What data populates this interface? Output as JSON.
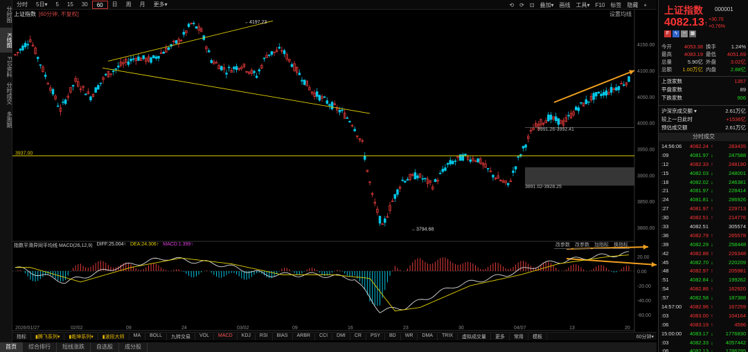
{
  "toolbar": {
    "items": [
      "分时",
      "5日▾",
      "5",
      "15",
      "30",
      "60",
      "日",
      "周",
      "月",
      "更多▾"
    ],
    "active_index": 5,
    "right_items": [
      "⟲",
      "⟳",
      "⊡",
      "叠加▾",
      "画线",
      "工具▾",
      "F10",
      "标签",
      "隐藏",
      "+"
    ]
  },
  "vtabs": [
    "分时图",
    "K线图",
    "F10资料",
    "分时成交",
    "多周期"
  ],
  "vtab_active": 1,
  "chart": {
    "title": "上证指数",
    "subtitle": "[60分钟, 不复权]",
    "settings": "设置均线",
    "y_labels": [
      "4150.00",
      "4100.00",
      "4050.00",
      "4000.00",
      "3950.00",
      "3900.00",
      "3850.00",
      "3800.00"
    ],
    "x_labels": [
      "2026/01/27",
      "02/02",
      "09",
      "24",
      "03/02",
      "09",
      "16",
      "23",
      "30",
      "04/07",
      "13",
      "20"
    ],
    "support_label": "3937.00",
    "annot_high": "4197.23",
    "annot_low": "3794.68",
    "annot_zone1": "3991.26-3992.41",
    "annot_zone2": "3891.02-3928.25",
    "colors": {
      "up": "#e83b3b",
      "down": "#00c8e8",
      "trend": "#e6d200",
      "arrow": "#f0a020"
    }
  },
  "indicator": {
    "label": "指数平滑异同平均线 MACD(26,12,9)",
    "diff": "DIFF:25.004↑",
    "dea": "DEA:24.306↑",
    "macd": "MACD:1.399↑",
    "buttons": [
      "改参数",
      "改参数",
      "加指标",
      "换指标"
    ],
    "y_labels": [
      "20.00",
      "0.00",
      "-20.00",
      "-40.00",
      "-60.00"
    ]
  },
  "ind_tabs": [
    "指标",
    "▮腾飞系列▾",
    "▮乾坤系列▾",
    "▮波段大师",
    "MA",
    "BOLL",
    "九转交易",
    "VOL",
    "MACD",
    "KDJ",
    "RSI",
    "BIAS",
    "ARBR",
    "CCI",
    "DMI",
    "CR",
    "PSY",
    "BD",
    "WR",
    "DMA",
    "TRIX",
    "虚拟成交量",
    "更多",
    "常用",
    "模板"
  ],
  "ind_tab_active": 8,
  "period": "60分钟▾",
  "sheet_tabs": [
    "首页",
    "综合排行",
    "短线涨跌",
    "自选股",
    "成分股"
  ],
  "quote": {
    "name": "上证指数",
    "code": "000001",
    "price": "4082.13",
    "arrow": "↑",
    "change": "+30.70",
    "change_pct": "+0.76%",
    "rows": [
      {
        "k": "今开",
        "v": "4053.38",
        "vc": "red",
        "k2": "换手",
        "v2": "1.24%",
        "v2c": "white"
      },
      {
        "k": "最高",
        "v": "4083.19",
        "vc": "red",
        "k2": "最低",
        "v2": "4051.69",
        "v2c": "red"
      },
      {
        "k": "总量",
        "v": "5.90亿",
        "vc": "white",
        "k2": "外盘",
        "v2": "3.02亿",
        "v2c": "red"
      },
      {
        "k": "总额",
        "v": "1.00万亿",
        "vc": "yellow",
        "k2": "内盘",
        "v2": "2.88亿",
        "v2c": "green"
      }
    ],
    "stats": [
      {
        "k": "上涨家数",
        "v": "1357",
        "c": "red"
      },
      {
        "k": "平盘家数",
        "v": "89",
        "c": "white"
      },
      {
        "k": "下跌家数",
        "v": "906",
        "c": "green"
      }
    ],
    "stats2": [
      {
        "k": "沪深京成交额 ▾",
        "v": "2.61万亿",
        "c": "white"
      },
      {
        "k": "较上一日此时",
        "v": "+1536亿",
        "c": "red"
      },
      {
        "k": "预估成交额",
        "v": "2.61万亿",
        "c": "white"
      }
    ],
    "ticks_header": "分时成交",
    "ticks": [
      {
        "t": "14:56:06",
        "p": "4082.24",
        "a": "↑",
        "v": "283435",
        "c": "red"
      },
      {
        "t": ":09",
        "p": "4081.97",
        "a": "↓",
        "v": "247588",
        "c": "green"
      },
      {
        "t": ":12",
        "p": "4082.33",
        "a": "↑",
        "v": "248190",
        "c": "red"
      },
      {
        "t": ":15",
        "p": "4082.03",
        "a": "↓",
        "v": "248001",
        "c": "green"
      },
      {
        "t": ":18",
        "p": "4082.02",
        "a": "↓",
        "v": "246381",
        "c": "green"
      },
      {
        "t": ":21",
        "p": "4081.97",
        "a": "↓",
        "v": "228414",
        "c": "green"
      },
      {
        "t": ":24",
        "p": "4081.81",
        "a": "↓",
        "v": "286926",
        "c": "green"
      },
      {
        "t": ":27",
        "p": "4081.97",
        "a": "↑",
        "v": "229713",
        "c": "red"
      },
      {
        "t": ":30",
        "p": "4082.51",
        "a": "↑",
        "v": "214776",
        "c": "red"
      },
      {
        "t": ":33",
        "p": "4082.51",
        "a": "",
        "v": "305574",
        "c": "white"
      },
      {
        "t": ":36",
        "p": "4082.79",
        "a": "↑",
        "v": "265578",
        "c": "red"
      },
      {
        "t": ":39",
        "p": "4082.29",
        "a": "↓",
        "v": "258448",
        "c": "green"
      },
      {
        "t": ":42",
        "p": "4082.88",
        "a": "↑",
        "v": "226348",
        "c": "red"
      },
      {
        "t": ":45",
        "p": "4082.70",
        "a": "↓",
        "v": "220209",
        "c": "green"
      },
      {
        "t": ":48",
        "p": "4082.97",
        "a": "↑",
        "v": "205981",
        "c": "red"
      },
      {
        "t": ":51",
        "p": "4082.84",
        "a": "↓",
        "v": "199262",
        "c": "green"
      },
      {
        "t": ":54",
        "p": "4082.86",
        "a": "↑",
        "v": "162920",
        "c": "red"
      },
      {
        "t": ":57",
        "p": "4082.58",
        "a": "↓",
        "v": "187388",
        "c": "green"
      },
      {
        "t": "14:57:00",
        "p": "4082.96",
        "a": "↑",
        "v": "167259",
        "c": "red"
      },
      {
        "t": ":03",
        "p": "4083.00",
        "a": "↑",
        "v": "104164",
        "c": "red"
      },
      {
        "t": ":06",
        "p": "4083.19",
        "a": "↑",
        "v": "4596",
        "c": "red"
      },
      {
        "t": "15:00:00",
        "p": "4083.17",
        "a": "↓",
        "v": "1776830",
        "c": "green"
      },
      {
        "t": ":03",
        "p": "4082.33",
        "a": "↓",
        "v": "4057442",
        "c": "green"
      },
      {
        "t": ":06",
        "p": "4082.13",
        "a": "↓",
        "v": "1786295",
        "c": "green"
      }
    ]
  }
}
